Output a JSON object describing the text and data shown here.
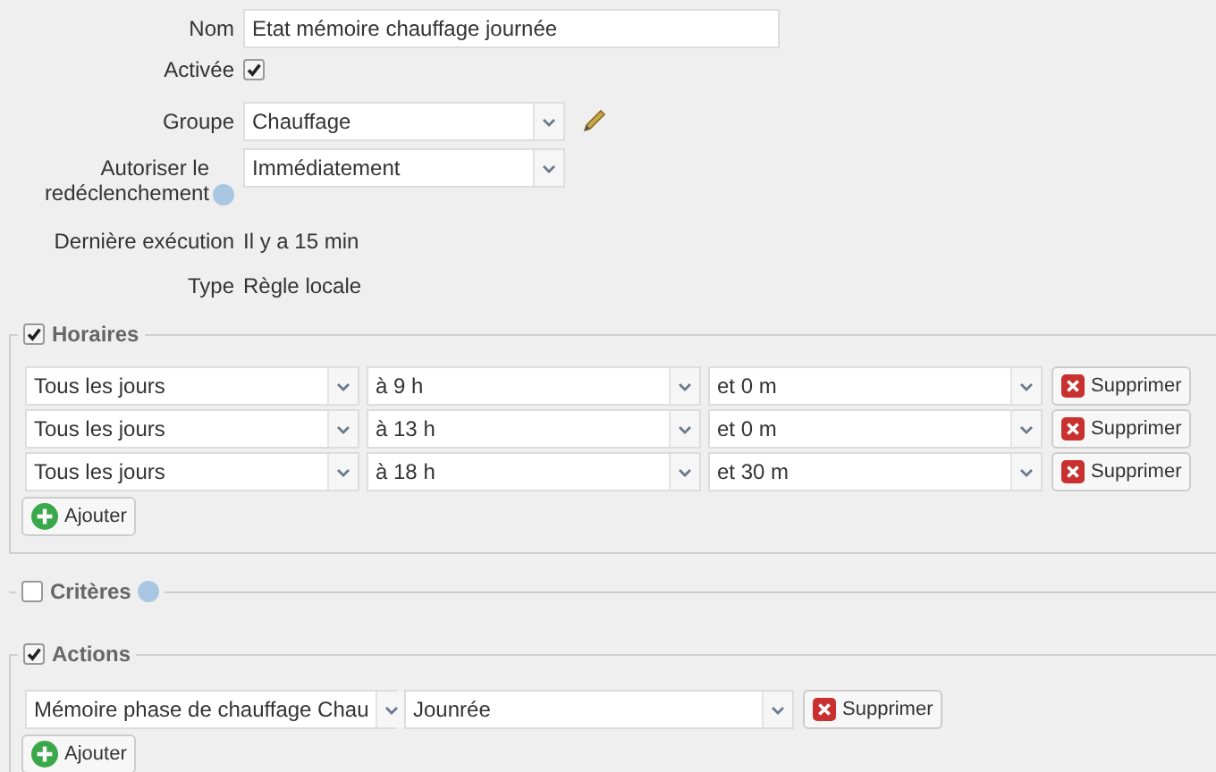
{
  "fields": [
    {
      "kind": "text",
      "label": "Nom",
      "value": "Etat mémoire chauffage journée",
      "help": false
    },
    {
      "kind": "checkbox",
      "label": "Activée",
      "checked": true,
      "help": false
    },
    {
      "kind": "select",
      "label": "Groupe",
      "value": "Chauffage",
      "editable": true,
      "help": false
    },
    {
      "kind": "select",
      "label": "Autoriser le redéclenchement",
      "value": "Immédiatement",
      "editable": false,
      "help": true
    },
    {
      "kind": "info",
      "label": "Dernière exécution",
      "value": "Il y a 15 min",
      "help": false
    },
    {
      "kind": "info",
      "label": "Type",
      "value": "Règle locale",
      "help": false
    }
  ],
  "sections": [
    {
      "kind": "schedule",
      "title": "Horaires",
      "checked": true,
      "help": false,
      "rows": [
        {
          "cells": [
            "Tous les jours",
            "à 9 h",
            "et 0 m"
          ],
          "remove": "Supprimer"
        },
        {
          "cells": [
            "Tous les jours",
            "à 13 h",
            "et 0 m"
          ],
          "remove": "Supprimer"
        },
        {
          "cells": [
            "Tous les jours",
            "à 18 h",
            "et 30 m"
          ],
          "remove": "Supprimer"
        }
      ],
      "add": "Ajouter"
    },
    {
      "kind": "criteria",
      "title": "Critères",
      "checked": false,
      "help": true
    },
    {
      "kind": "action",
      "title": "Actions",
      "checked": true,
      "help": false,
      "rows": [
        {
          "cells": [
            "Mémoire phase de chauffage Chau",
            "Jounrée"
          ],
          "remove": "Supprimer"
        }
      ],
      "add": "Ajouter"
    }
  ]
}
